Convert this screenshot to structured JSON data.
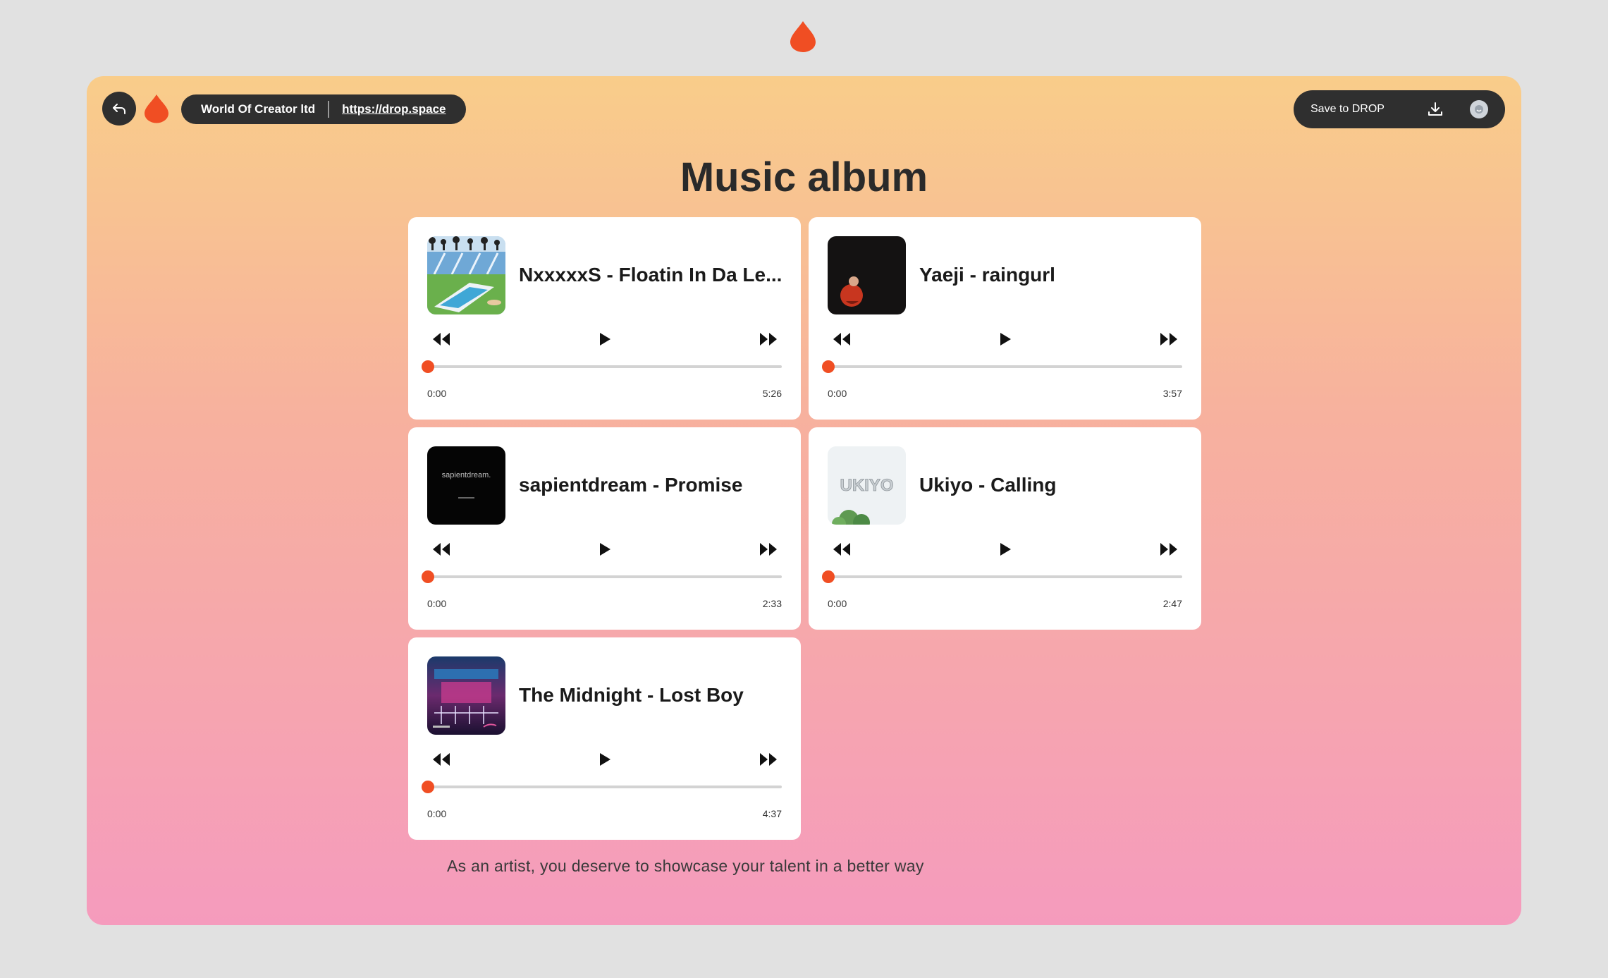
{
  "header": {
    "org_name": "World Of Creator ltd",
    "link": "https://drop.space",
    "save_label": "Save to DROP"
  },
  "page": {
    "title": "Music album",
    "footer": "As an artist, you deserve to showcase your talent in a better way"
  },
  "colors": {
    "accent": "#f04e23",
    "dark": "#2f2f2f",
    "gradient_top": "#f9cd8a",
    "gradient_bottom": "#f59bbd"
  },
  "tracks": [
    {
      "title": "NxxxxxS - Floatin In Da Le...",
      "current": "0:00",
      "duration": "5:26",
      "progress": 0
    },
    {
      "title": "Yaeji - raingurl",
      "current": "0:00",
      "duration": "3:57",
      "progress": 0
    },
    {
      "title": "sapientdream - Promise",
      "current": "0:00",
      "duration": "2:33",
      "progress": 0,
      "cover_text": "sapientdream."
    },
    {
      "title": "Ukiyo - Calling",
      "current": "0:00",
      "duration": "2:47",
      "progress": 0,
      "cover_text": "UKIYO"
    },
    {
      "title": "The Midnight - Lost Boy",
      "current": "0:00",
      "duration": "4:37",
      "progress": 0
    }
  ],
  "icons": {
    "back": "back-arrow-icon",
    "logo": "drop-logo-icon",
    "download": "download-icon",
    "avatar": "avatar-icon",
    "rewind": "rewind-icon",
    "play": "play-icon",
    "forward": "fast-forward-icon"
  }
}
